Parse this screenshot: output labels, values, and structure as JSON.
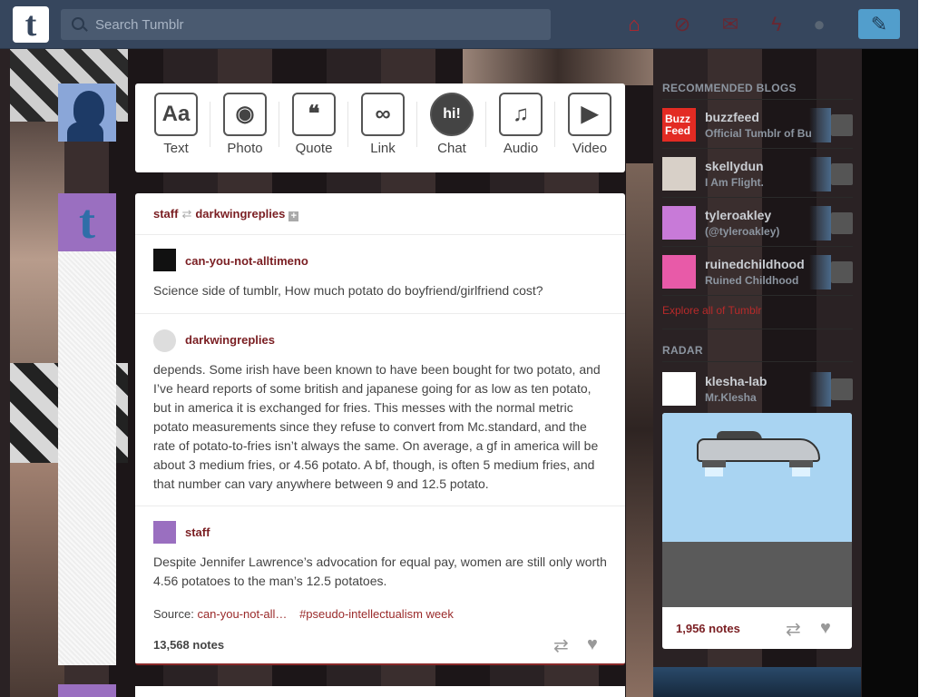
{
  "header": {
    "logo_letter": "t",
    "search_placeholder": "Search Tumblr",
    "icons": [
      "home-icon",
      "explore-icon",
      "inbox-icon",
      "activity-icon",
      "account-icon"
    ],
    "compose_icon": "pencil-icon"
  },
  "post_types": [
    {
      "label": "Text",
      "glyph": "Aa",
      "icon": "text-icon"
    },
    {
      "label": "Photo",
      "glyph": "◉",
      "icon": "photo-icon"
    },
    {
      "label": "Quote",
      "glyph": "❝",
      "icon": "quote-icon"
    },
    {
      "label": "Link",
      "glyph": "∞",
      "icon": "link-icon"
    },
    {
      "label": "Chat",
      "glyph": "hi!",
      "icon": "chat-icon"
    },
    {
      "label": "Audio",
      "glyph": "♫",
      "icon": "audio-icon"
    },
    {
      "label": "Video",
      "glyph": "▶",
      "icon": "video-icon"
    }
  ],
  "post": {
    "poster": "staff",
    "reblogged_from": "darkwingreplies",
    "threads": [
      {
        "blog": "can-you-not-alltimeno",
        "text": "Science side of tumblr, How much potato do boyfriend/girlfriend cost?"
      },
      {
        "blog": "darkwingreplies",
        "text": "depends. Some irish have been known to have been bought for two potato, and I’ve heard reports of some british and japanese going for as low as ten potato, but in america it is exchanged for fries. This messes with the normal metric potato measurements since they refuse to convert from Mc.standard, and the rate of potato-to-fries isn’t always the same. On average, a gf in america will be about 3 medium fries, or 4.56 potato. A bf, though, is often 5 medium fries, and that number can vary anywhere between 9 and 12.5 potato."
      },
      {
        "blog": "staff",
        "text": "Despite Jennifer Lawrence’s advocation for equal pay, women are still only worth 4.56 potatoes to the man’s 12.5 potatoes."
      }
    ],
    "source_label": "Source:",
    "source_link": "can-you-not-all…",
    "tag": "#pseudo-intellectualism week",
    "notes": "13,568 notes"
  },
  "sidebar": {
    "recommended_heading": "RECOMMENDED BLOGS",
    "recommended": [
      {
        "name": "buzzfeed",
        "title": "Official Tumblr of Bu",
        "avatar_color": "#e32b23",
        "avatar_text": "Buzz Feed"
      },
      {
        "name": "skellydun",
        "title": "I Am Flight.",
        "avatar_color": "#d8d0c8",
        "avatar_text": ""
      },
      {
        "name": "tyleroakley",
        "title": "(@tyleroakley)",
        "avatar_color": "#c87ad8",
        "avatar_text": ""
      },
      {
        "name": "ruinedchildhood",
        "title": "Ruined Childhood",
        "avatar_color": "#e85aa8",
        "avatar_text": ""
      }
    ],
    "explore_link": "Explore all of Tumblr",
    "radar_heading": "RADAR",
    "radar": {
      "name": "klesha-lab",
      "title": "Mr.Klesha",
      "notes": "1,956 notes"
    }
  }
}
